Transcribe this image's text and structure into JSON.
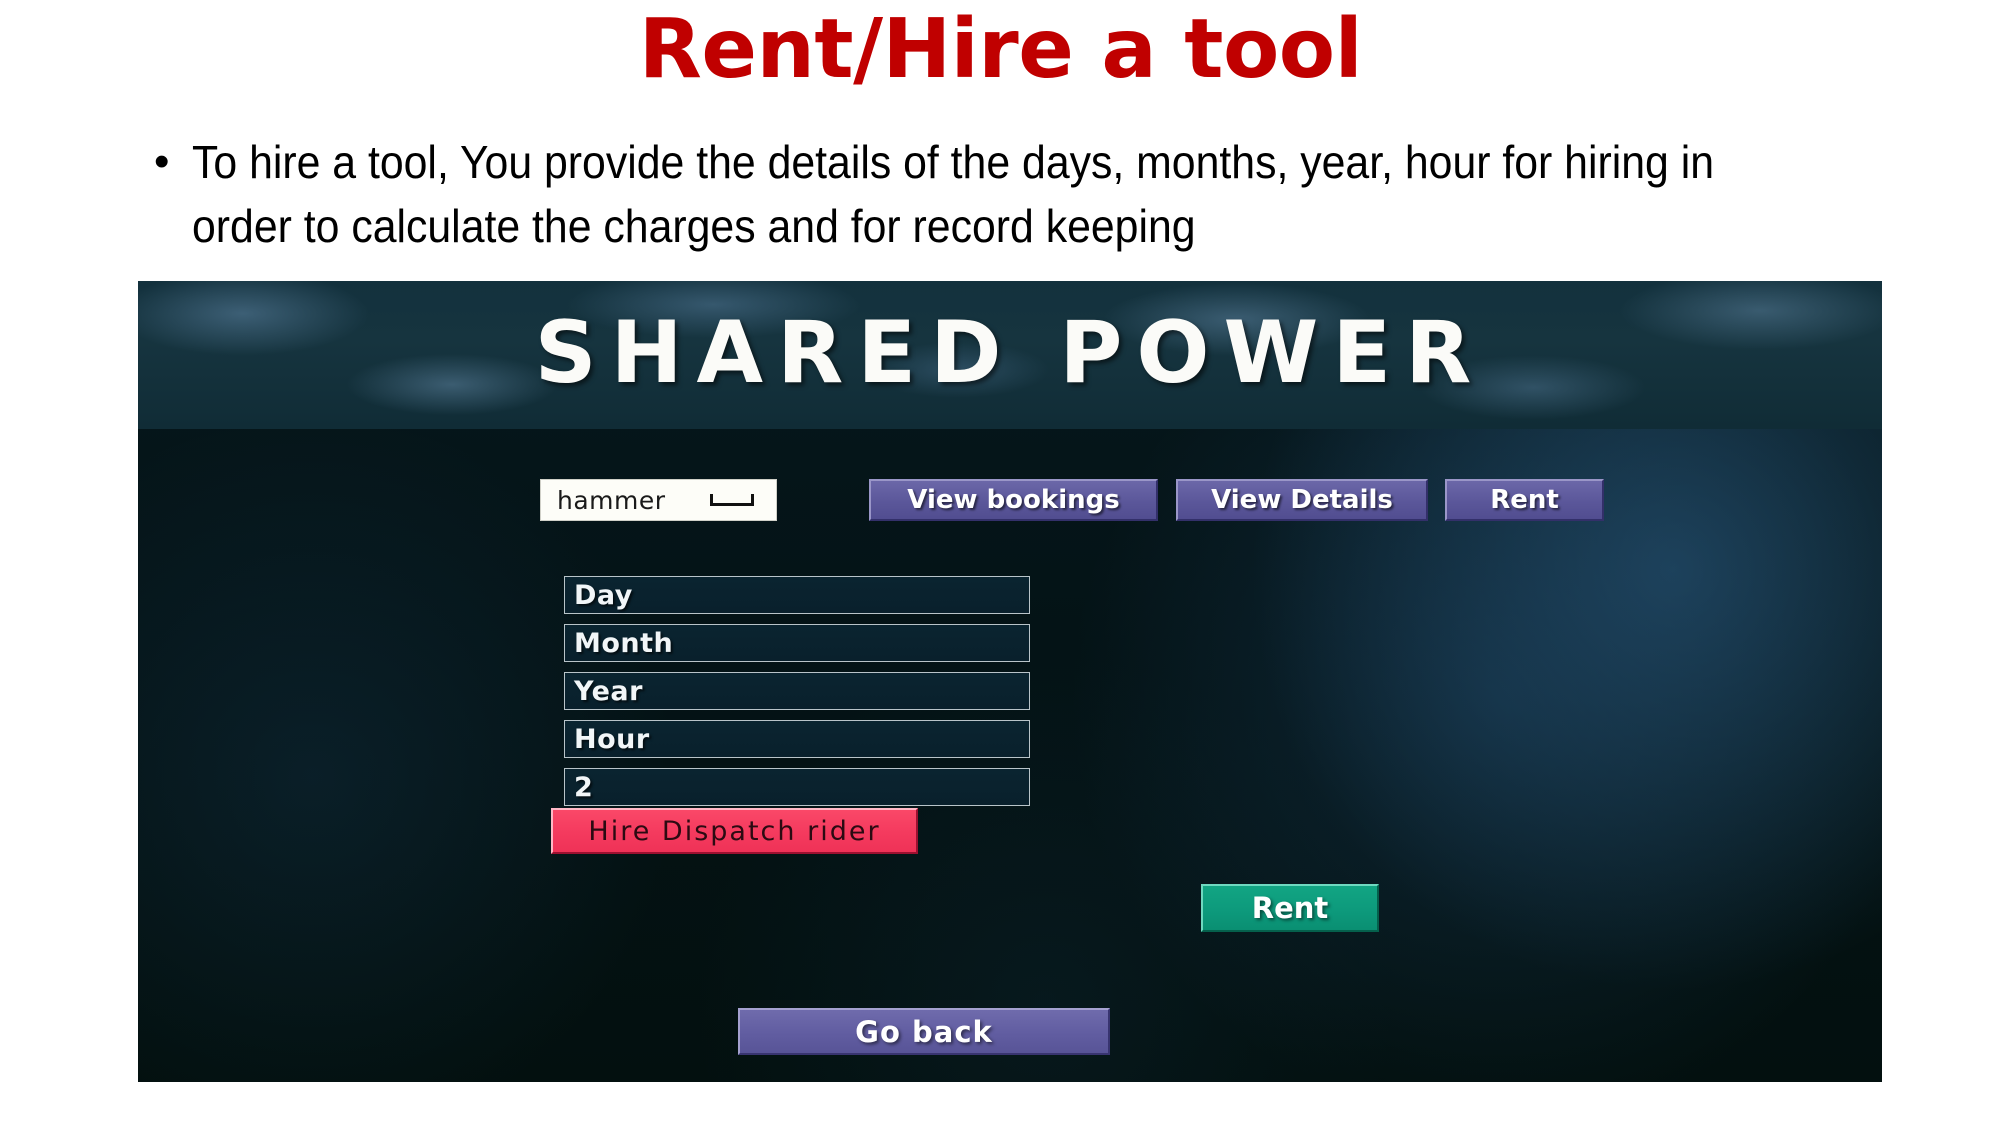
{
  "slide": {
    "title": "Rent/Hire a tool",
    "title_color": "#c00000",
    "bullet_marker": "•",
    "bullet_text": "To hire a tool, You provide the details of the days, months, year, hour for hiring in order to calculate the charges and for record keeping"
  },
  "app": {
    "banner_title": "SHARED POWER",
    "background_color": "#041316",
    "toolbar": {
      "tool_select": {
        "value": "hammer",
        "arrow_icon": "dropdown-bar-icon"
      },
      "buttons": [
        {
          "label": "View bookings",
          "color": "#5b579a"
        },
        {
          "label": "View Details",
          "color": "#5b579a"
        },
        {
          "label": "Rent",
          "color": "#5b579a"
        }
      ]
    },
    "fields": [
      {
        "name": "day-field",
        "value": "Day"
      },
      {
        "name": "month-field",
        "value": "Month"
      },
      {
        "name": "year-field",
        "value": "Year"
      },
      {
        "name": "hour-field",
        "value": "Hour"
      },
      {
        "name": "quantity-field",
        "value": "2"
      }
    ],
    "dispatch_button": {
      "label": "Hire Dispatch rider",
      "color": "#f43a5e"
    },
    "rent_button": {
      "label": "Rent",
      "color": "#0d9a7c"
    },
    "goback_button": {
      "label": "Go back",
      "color": "#615da1"
    }
  }
}
